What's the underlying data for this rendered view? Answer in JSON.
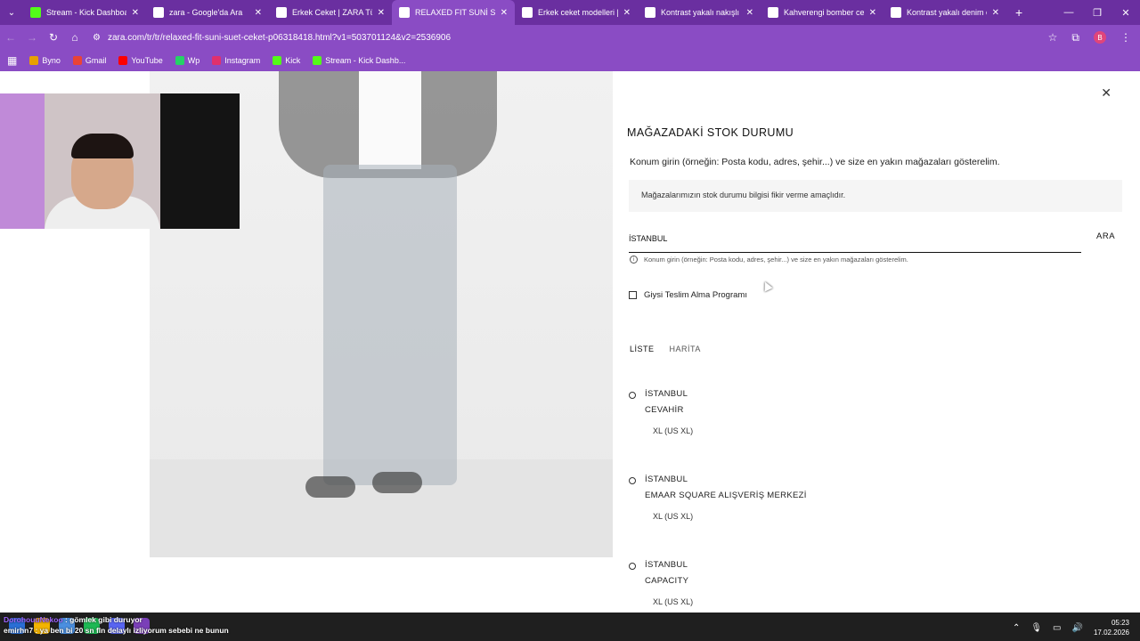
{
  "browser": {
    "tabs": [
      {
        "title": "Stream - Kick Dashboard",
        "color": "#53fc18"
      },
      {
        "title": "zara - Google'da Ara",
        "color": "#ffffff"
      },
      {
        "title": "Erkek Ceket | ZARA Türkiy",
        "color": "#ffffff"
      },
      {
        "title": "RELAXED FIT SUNİ SÜET C",
        "color": "#ffffff"
      },
      {
        "title": "Erkek ceket modelleri | Pu",
        "color": "#ffffff"
      },
      {
        "title": "Kontrast yakalı nakışlı cek",
        "color": "#ffffff"
      },
      {
        "title": "Kahverengi bomber ceket",
        "color": "#ffffff"
      },
      {
        "title": "Kontrast yakalı denim cek",
        "color": "#ffffff"
      }
    ],
    "active_tab": 3,
    "url": "zara.com/tr/tr/relaxed-fit-suni-suet-ceket-p06318418.html?v1=503701124&v2=2536906",
    "bookmarks": [
      {
        "label": "Byno",
        "color": "#e8a000"
      },
      {
        "label": "Gmail",
        "color": "#ea4335"
      },
      {
        "label": "YouTube",
        "color": "#ff0000"
      },
      {
        "label": "Wp",
        "color": "#25d366"
      },
      {
        "label": "Instagram",
        "color": "#e1306c"
      },
      {
        "label": "Kick",
        "color": "#53fc18"
      },
      {
        "label": "Stream - Kick Dashb...",
        "color": "#53fc18"
      }
    ],
    "profile_initial": "B"
  },
  "panel": {
    "title": "MAĞAZADAKİ STOK DURUMU",
    "description": "Konum girin (örneğin: Posta kodu, adres, şehir...) ve size en yakın mağazaları gösterelim.",
    "notice": "Mağazalarımızın stok durumu bilgisi fikir verme amaçlıdır.",
    "search_value": "İSTANBUL",
    "search_button": "ARA",
    "hint": "Konum girin (örneğin: Posta kodu, adres, şehir...) ve size en yakın mağazaları gösterelim.",
    "pickup_label": "Giysi Teslim Alma Programı",
    "views": {
      "list": "LİSTE",
      "map": "HARİTA"
    },
    "stores": [
      {
        "city": "İSTANBUL",
        "name": "CEVAHİR",
        "size": "XL (US XL)"
      },
      {
        "city": "İSTANBUL",
        "name": "EMAAR SQUARE ALIŞVERİŞ MERKEZİ",
        "size": "XL (US XL)"
      },
      {
        "city": "İSTANBUL",
        "name": "CAPACITY",
        "size": "XL (US XL)"
      }
    ]
  },
  "chat": {
    "line1_user": "DorohouuNekoo",
    "line1_text": ": gömlek gibi duruyor",
    "line2_user": "emirhn7",
    "line2_text": ": ya ben bi 20 sn fln delaylı izliyorum sebebi ne bunun"
  },
  "taskbar": {
    "time": "05:23",
    "date": "17.02.2026"
  }
}
